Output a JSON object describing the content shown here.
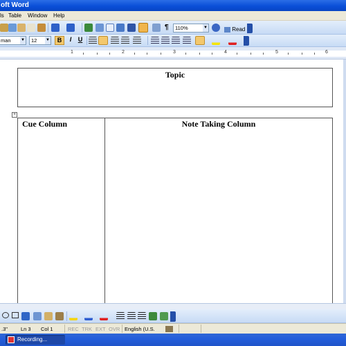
{
  "window": {
    "title": "oft Word"
  },
  "menu": {
    "items": [
      "ls",
      "Table",
      "Window",
      "Help"
    ]
  },
  "toolbar": {
    "zoom": "110%",
    "read_label": "Read",
    "font_name": "man",
    "font_size": "12",
    "bold_label": "B",
    "italic_label": "I",
    "underline_label": "U",
    "pilcrow": "¶"
  },
  "ruler": {
    "labels": [
      "1",
      "2",
      "3",
      "4",
      "5",
      "6"
    ]
  },
  "document": {
    "topic": "Topic",
    "table": {
      "col1_header": "Cue Column",
      "col2_header": "Note Taking Column"
    }
  },
  "status": {
    "at": ".3\"",
    "line": "Ln 3",
    "col": "Col 1",
    "rec": "REC",
    "trk": "TRK",
    "ext": "EXT",
    "ovr": "OVR",
    "language": "English (U.S."
  },
  "taskbar": {
    "item": "Recording..."
  },
  "colors": {
    "title_blue": "#0a4fd8",
    "toolbar": "#c7dbf5",
    "taskbar": "#245edb"
  }
}
